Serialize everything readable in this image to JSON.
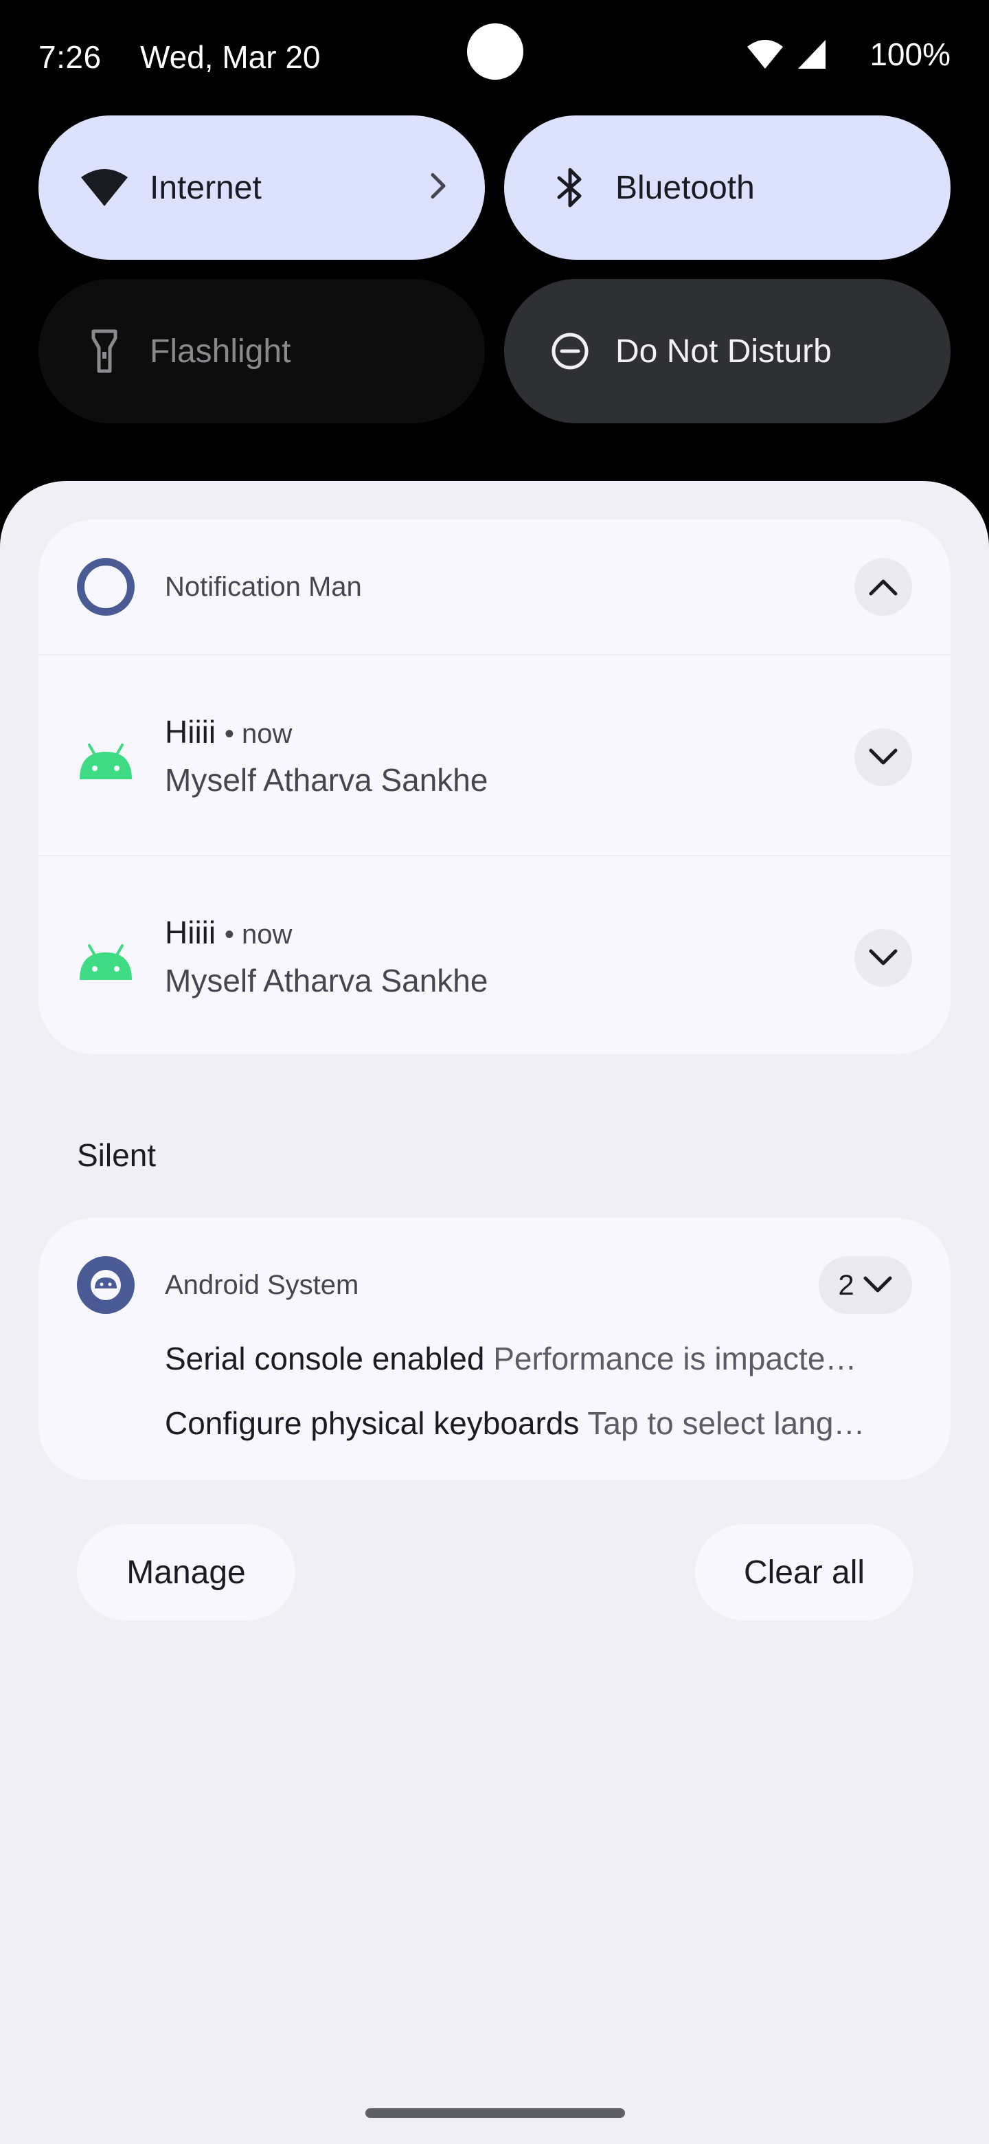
{
  "status_bar": {
    "time": "7:26",
    "date": "Wed, Mar 20",
    "battery": "100%",
    "icons": [
      "wifi-icon",
      "cellular-signal-icon"
    ]
  },
  "quick_settings": [
    {
      "label": "Internet",
      "icon": "wifi-icon",
      "state": "on",
      "has_chevron": true
    },
    {
      "label": "Bluetooth",
      "icon": "bluetooth-icon",
      "state": "on"
    },
    {
      "label": "Flashlight",
      "icon": "flashlight-icon",
      "state": "unavailable"
    },
    {
      "label": "Do Not Disturb",
      "icon": "do-not-disturb-icon",
      "state": "off"
    }
  ],
  "notification_group": {
    "app_name": "Notification Man",
    "items": [
      {
        "title": "Hiiii",
        "time": "now",
        "text": "Myself Atharva Sankhe"
      },
      {
        "title": "Hiiii",
        "time": "now",
        "text": "Myself Atharva Sankhe"
      }
    ]
  },
  "silent_section": {
    "header": "Silent",
    "app_name": "Android System",
    "count": "2",
    "lines": [
      {
        "title": "Serial console enabled",
        "text": "Performance is impacte…"
      },
      {
        "title": "Configure physical keyboards",
        "text": "Tap to select lang…"
      }
    ]
  },
  "actions": {
    "manage": "Manage",
    "clear_all": "Clear all"
  },
  "colors": {
    "tile_on": "#dce2fc",
    "tile_dnd": "#2f3034",
    "shade_bg": "#f0eff5",
    "card_bg": "#f8f7fd",
    "android_green": "#3ddc84",
    "accent_ring": "#4a5a94"
  }
}
